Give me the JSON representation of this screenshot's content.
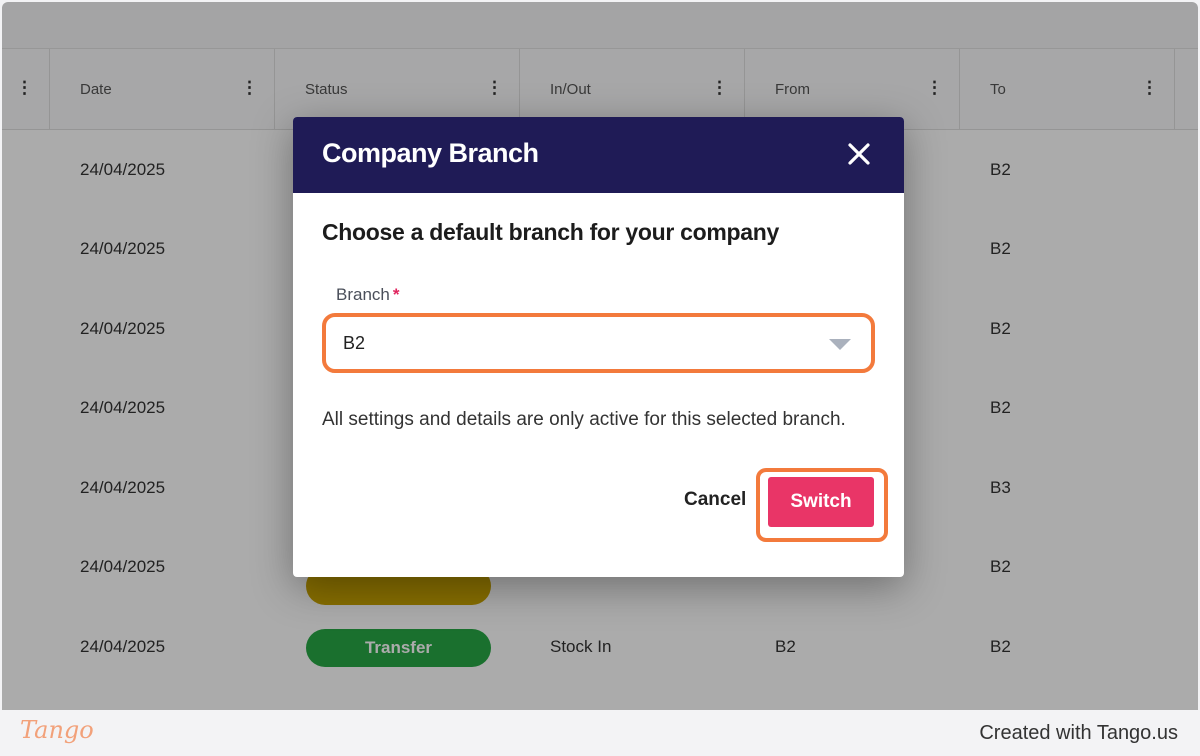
{
  "table": {
    "columns": [
      {
        "label": ""
      },
      {
        "label": "Date"
      },
      {
        "label": "Status"
      },
      {
        "label": "In/Out"
      },
      {
        "label": "From"
      },
      {
        "label": "To"
      }
    ],
    "rows": [
      {
        "date": "24/04/2025",
        "to": "B2"
      },
      {
        "date": "24/04/2025",
        "to": "B2"
      },
      {
        "date": "24/04/2025",
        "to": "B2"
      },
      {
        "date": "24/04/2025",
        "to": "B2"
      },
      {
        "date": "24/04/2025",
        "to": "B3"
      },
      {
        "date": "24/04/2025",
        "to": "B2"
      },
      {
        "date": "24/04/2025",
        "status": "Transfer",
        "in_out": "Stock In",
        "from": "B2",
        "to": "B2"
      }
    ]
  },
  "colors": {
    "header_bg": "#1f1b56",
    "accent": "#e93567",
    "highlight": "#f37a3c",
    "transfer": "#27a845",
    "pending": "#c9a400"
  },
  "dialog": {
    "title": "Company Branch",
    "close_icon": "close-icon",
    "subtitle": "Choose a default branch for your company",
    "field_label": "Branch",
    "required_mark": "*",
    "selected_value": "B2",
    "note": "All settings and details are only active for this selected branch.",
    "cancel_label": "Cancel",
    "switch_label": "Switch"
  },
  "footer": {
    "logo": "Tango",
    "text": "Created with Tango.us"
  }
}
